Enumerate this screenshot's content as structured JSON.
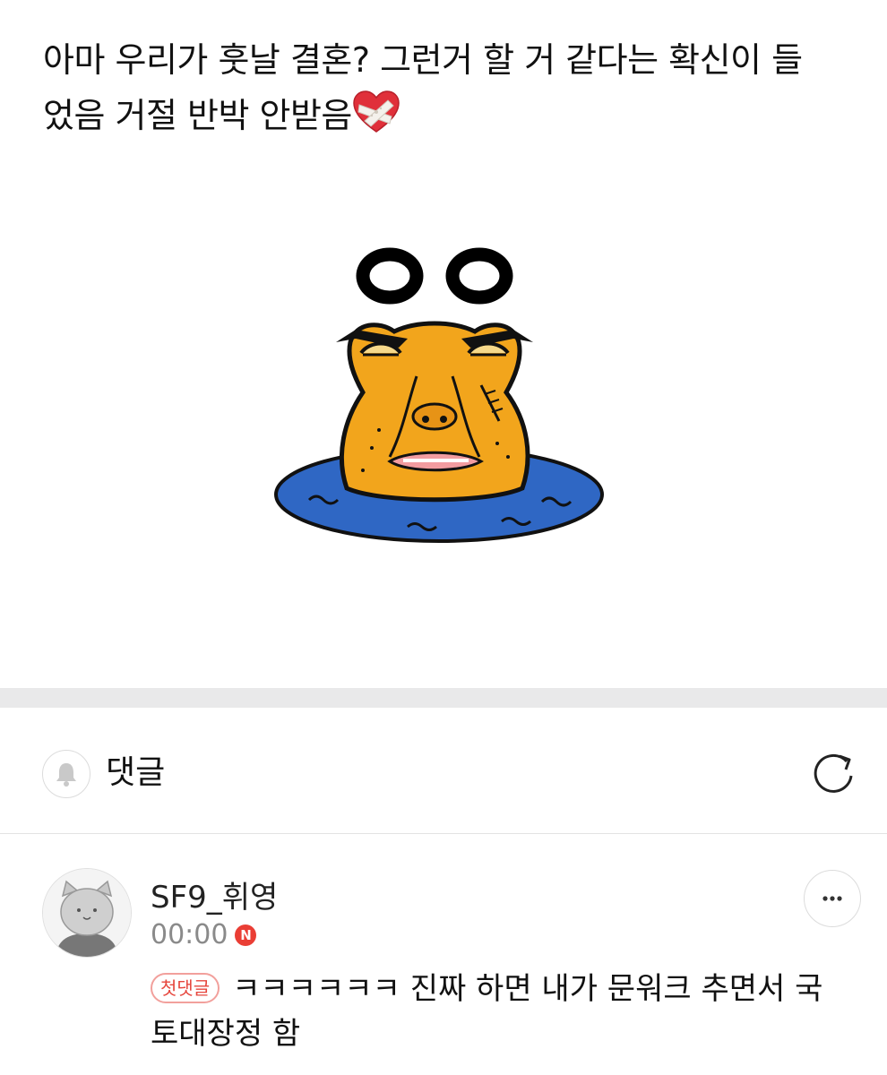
{
  "post": {
    "line1": "아마 우리가 훗날 결혼? 그런거 할 거 같다는 확신이 들",
    "line2": "었음 거절 반박 안받음",
    "emoji": "mending-heart-emoji"
  },
  "sticker": {
    "icon": "frog-in-water-sticker",
    "caption": "ㅇㅇ"
  },
  "comments_section": {
    "title": "댓글",
    "bell_icon": "bell-icon",
    "refresh_icon": "refresh-icon"
  },
  "comment": {
    "username": "SF9_휘영",
    "time": "00:00",
    "new_badge": "N",
    "first_badge": "첫댓글",
    "text_line1": "ㅋㅋㅋㅋㅋㅋ 진짜 하면 내가 문워크 추면서 국",
    "text_line2": "토대장정 함",
    "more_icon": "more-icon"
  },
  "colors": {
    "accent_red": "#ea3e35",
    "divider": "#e9e9ea",
    "muted_text": "#8a8a8a"
  }
}
